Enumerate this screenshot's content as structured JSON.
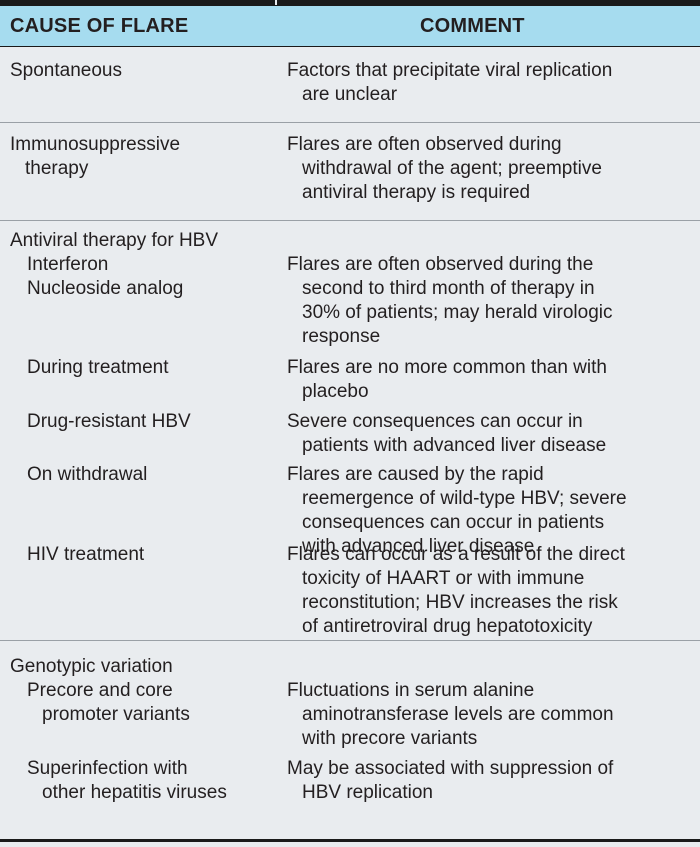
{
  "header": {
    "col1": "CAUSE OF FLARE",
    "col2": "COMMENT"
  },
  "sections": {
    "spontaneous": {
      "cause": "Spontaneous",
      "comment_l1": "Factors that precipitate viral replication",
      "comment_l2": "are unclear"
    },
    "immuno": {
      "cause_l1": "Immunosuppressive",
      "cause_l2": "therapy",
      "comment_l1": "Flares are often observed during",
      "comment_l2": "withdrawal of the agent; preemptive",
      "comment_l3": "antiviral therapy is required"
    },
    "antiviral": {
      "title": "Antiviral therapy for HBV",
      "interferon": "Interferon",
      "nucleoside": "Nucleoside analog",
      "interferon_comment_l1": "Flares are often observed during the",
      "interferon_comment_l2": "second to third month of therapy in",
      "interferon_comment_l3": "30% of patients; may herald virologic",
      "interferon_comment_l4": "response",
      "during": "During treatment",
      "during_comment_l1": "Flares are no more common than with",
      "during_comment_l2": "placebo",
      "resistant": "Drug-resistant HBV",
      "resistant_comment_l1": "Severe consequences can occur in",
      "resistant_comment_l2": "patients with advanced liver disease",
      "withdrawal": "On withdrawal",
      "withdrawal_comment_l1": "Flares are caused by the rapid",
      "withdrawal_comment_l2": "reemergence of wild-type HBV; severe",
      "withdrawal_comment_l3": "consequences can occur in patients",
      "withdrawal_comment_l4": "with advanced liver disease",
      "hiv": "HIV treatment",
      "hiv_comment_l1": "Flares can occur as a result of the direct",
      "hiv_comment_l2": "toxicity of HAART or with immune",
      "hiv_comment_l3": "reconstitution; HBV increases the risk",
      "hiv_comment_l4": "of antiretroviral drug hepatotoxicity"
    },
    "genotypic": {
      "title": "Genotypic variation",
      "precore_l1": "Precore and core",
      "precore_l2": "promoter variants",
      "precore_comment_l1": "Fluctuations in serum alanine",
      "precore_comment_l2": "aminotransferase levels are common",
      "precore_comment_l3": "with precore variants",
      "super_l1": "Superinfection with",
      "super_l2": "other hepatitis viruses",
      "super_comment_l1": "May be associated with suppression of",
      "super_comment_l2": "HBV replication"
    }
  },
  "colors": {
    "header_bg": "#a6dcef",
    "body_bg": "#e9ecef",
    "rule": "#1a1a1a"
  }
}
